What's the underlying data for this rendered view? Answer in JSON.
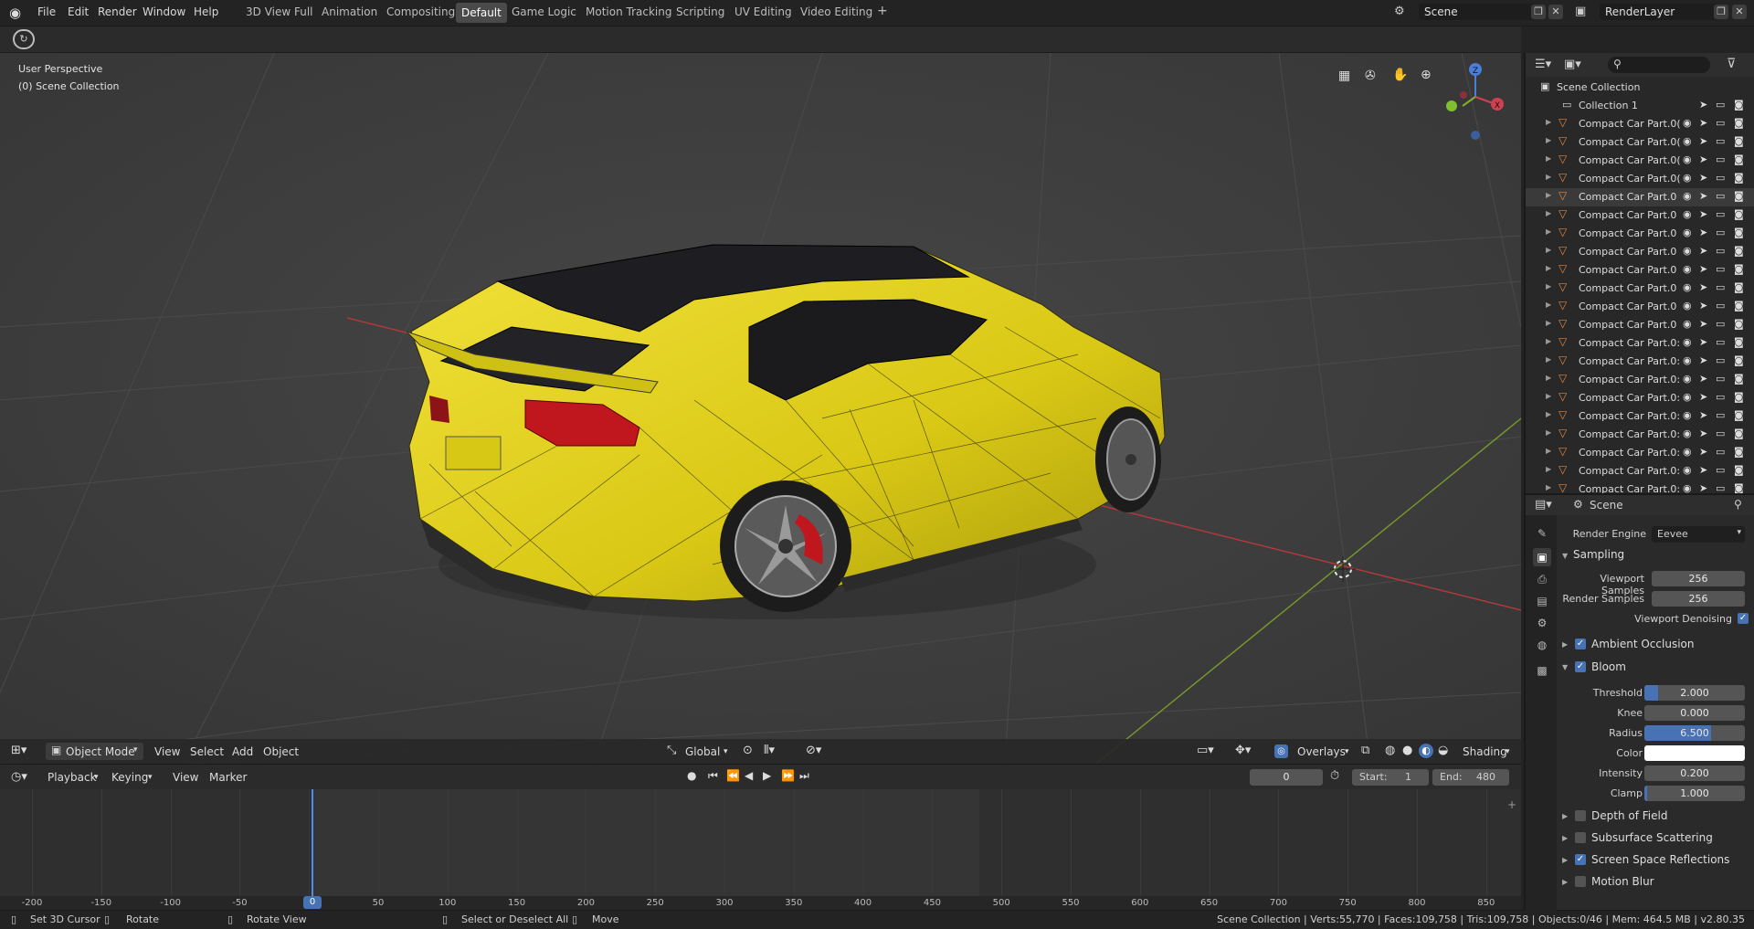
{
  "menu": {
    "items": [
      "File",
      "Edit",
      "Render",
      "Window",
      "Help"
    ],
    "workspaces": [
      "3D View Full",
      "Animation",
      "Compositing",
      "Default",
      "Game Logic",
      "Motion Tracking",
      "Scripting",
      "UV Editing",
      "Video Editing"
    ],
    "add_tab": "+",
    "active_workspace": "Default"
  },
  "scene_field": "Scene",
  "render_layer_field": "RenderLayer",
  "viewport": {
    "perspective": "User Perspective",
    "collection": "(0) Scene Collection",
    "gizmo_z": "Z",
    "gizmo_x": "X"
  },
  "viewport_header": {
    "mode": "Object Mode",
    "menus": [
      "View",
      "Select",
      "Add",
      "Object"
    ],
    "transform": "Global",
    "overlays": "Overlays",
    "shading": "Shading"
  },
  "timeline_header": {
    "menus": [
      "Playback",
      "Keying",
      "View",
      "Marker"
    ],
    "current_frame": "0",
    "start_label": "Start:",
    "start": "1",
    "end_label": "End:",
    "end": "480"
  },
  "timeline": {
    "ticks": [
      "-200",
      "-150",
      "-100",
      "-50",
      "0",
      "50",
      "100",
      "150",
      "200",
      "250",
      "300",
      "350",
      "400",
      "450",
      "500",
      "550",
      "600",
      "650",
      "700",
      "750",
      "800",
      "850"
    ],
    "current": "0"
  },
  "outliner": {
    "root": "Scene Collection",
    "collection": "Collection 1",
    "items": [
      "Compact Car Part.0(",
      "Compact Car Part.0(",
      "Compact Car Part.0(",
      "Compact Car Part.0(",
      "Compact Car Part.0",
      "Compact Car Part.0",
      "Compact Car Part.0",
      "Compact Car Part.0",
      "Compact Car Part.0",
      "Compact Car Part.0",
      "Compact Car Part.0",
      "Compact Car Part.0",
      "Compact Car Part.0:",
      "Compact Car Part.0:",
      "Compact Car Part.0:",
      "Compact Car Part.0:",
      "Compact Car Part.0:",
      "Compact Car Part.0:",
      "Compact Car Part.0:",
      "Compact Car Part.0:",
      "Compact Car Part.0:",
      "Compact Car Part.0("
    ],
    "selected_index": 4
  },
  "properties": {
    "header": "Scene",
    "render_engine_label": "Render Engine",
    "render_engine": "Eevee",
    "sampling": "Sampling",
    "viewport_samples_label": "Viewport Samples",
    "viewport_samples": "256",
    "render_samples_label": "Render Samples",
    "render_samples": "256",
    "viewport_denoising": "Viewport Denoising",
    "ambient_occlusion": "Ambient Occlusion",
    "bloom": "Bloom",
    "threshold_label": "Threshold",
    "threshold": "2.000",
    "knee_label": "Knee",
    "knee": "0.000",
    "radius_label": "Radius",
    "radius": "6.500",
    "color_label": "Color",
    "intensity_label": "Intensity",
    "intensity": "0.200",
    "clamp_label": "Clamp",
    "clamp": "1.000",
    "depth_of_field": "Depth of Field",
    "subsurface_scattering": "Subsurface Scattering",
    "screen_space_reflections": "Screen Space Reflections",
    "motion_blur": "Motion Blur"
  },
  "statusbar": {
    "set_cursor": "Set 3D Cursor",
    "rotate": "Rotate",
    "rotate_view": "Rotate View",
    "select": "Select or Deselect All",
    "move": "Move",
    "stats": "Scene Collection | Verts:55,770 | Faces:109,758 | Tris:109,758 | Objects:0/46 | Mem: 464.5 MB | v2.80.35"
  },
  "colors": {
    "car_body": "#e3d21a",
    "accent": "#4772b3",
    "x_axis": "#b23a3a",
    "y_axis": "#7a9a2a",
    "brake": "#c0161e"
  }
}
